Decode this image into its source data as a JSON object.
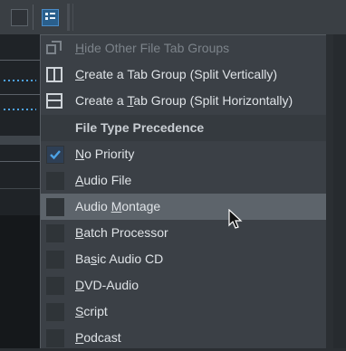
{
  "toolbar": {
    "buttons": [
      "layout-toggle-icon",
      "tab-groups-icon"
    ]
  },
  "menu": {
    "items": [
      {
        "label": "Hide Other File Tab Groups",
        "mnemonic": "H",
        "icon": "tab-groups-icon",
        "enabled": false
      },
      {
        "label": "Create a Tab Group (Split Vertically)",
        "mnemonic": "C",
        "icon": "split-vertical-icon",
        "enabled": true
      },
      {
        "label": "Create a Tab Group (Split Horizontally)",
        "mnemonic": "T",
        "icon": "split-horizontal-icon",
        "enabled": true
      }
    ],
    "section_header": "File Type Precedence",
    "options": [
      {
        "pre": "",
        "u": "N",
        "post": "o Priority",
        "checked": true
      },
      {
        "pre": "",
        "u": "A",
        "post": "udio File",
        "checked": false
      },
      {
        "pre": "Audio ",
        "u": "M",
        "post": "ontage",
        "checked": false,
        "hovered": true
      },
      {
        "pre": "",
        "u": "B",
        "post": "atch Processor",
        "checked": false
      },
      {
        "pre": "Ba",
        "u": "s",
        "post": "ic Audio CD",
        "checked": false
      },
      {
        "pre": "",
        "u": "D",
        "post": "VD-Audio",
        "checked": false
      },
      {
        "pre": "",
        "u": "S",
        "post": "cript",
        "checked": false
      },
      {
        "pre": "",
        "u": "P",
        "post": "odcast",
        "checked": false
      }
    ]
  },
  "colors": {
    "accent": "#4a8cc8",
    "check": "#4da3e6",
    "highlight": "#5d646b"
  }
}
